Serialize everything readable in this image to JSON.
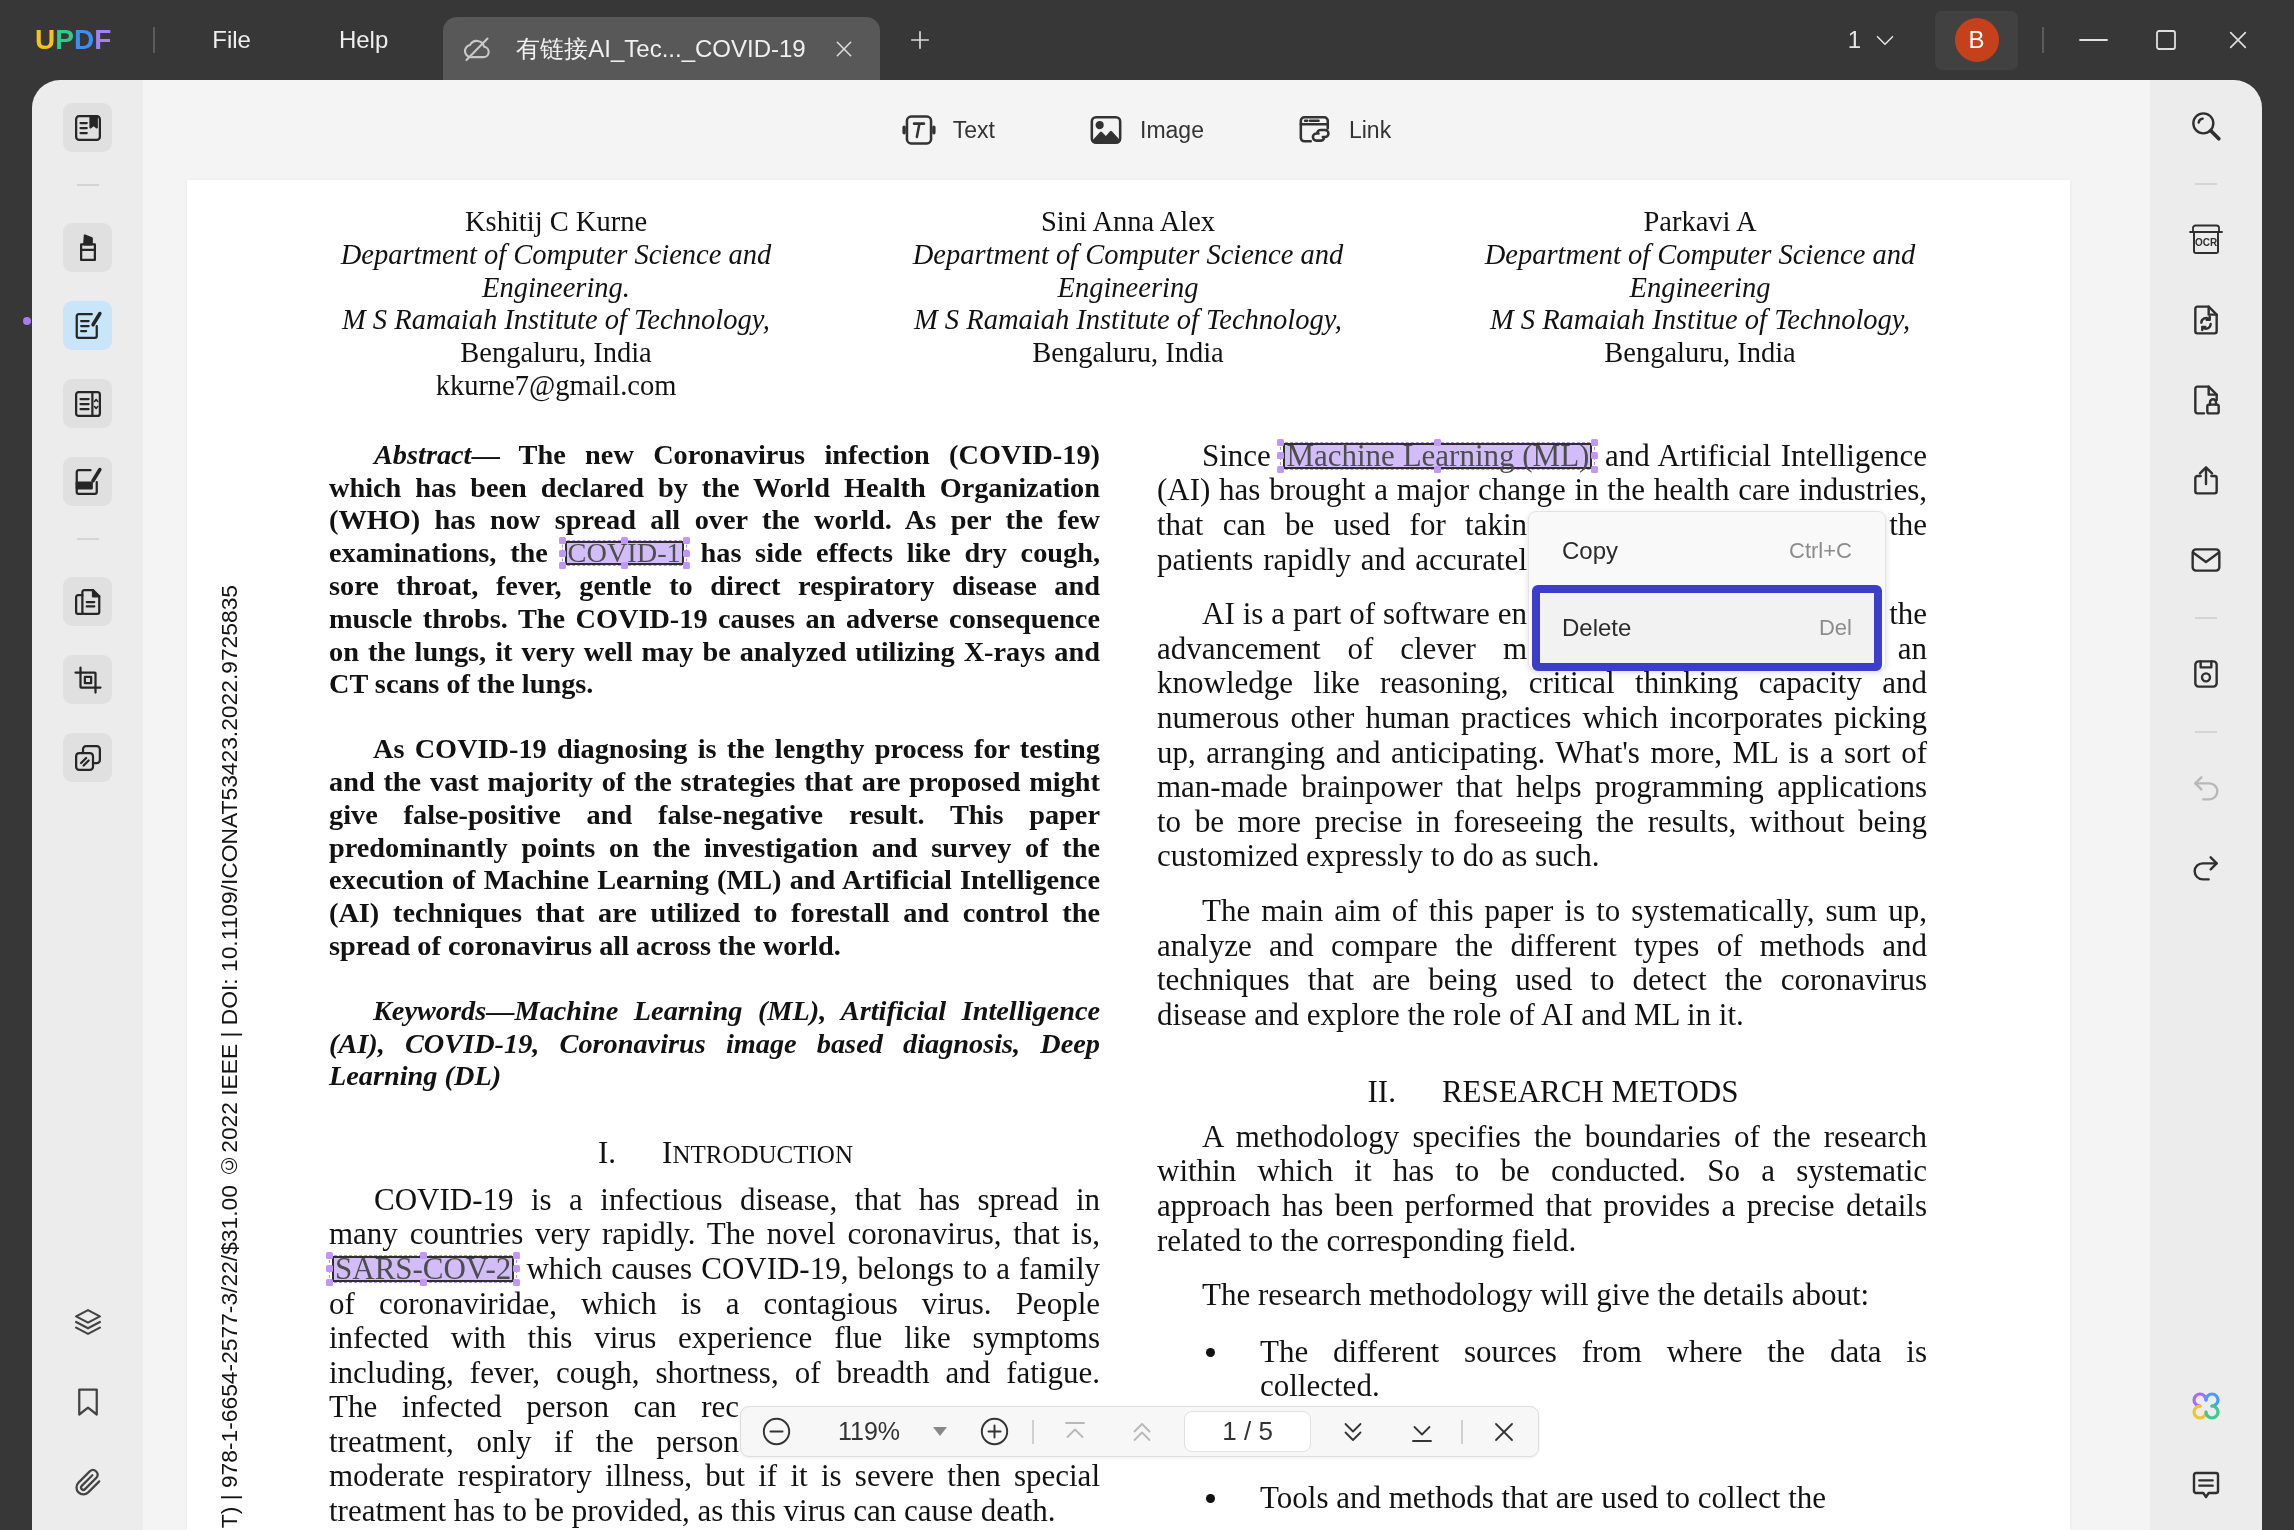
{
  "title_bar": {
    "logo": "UPDF",
    "menu": [
      "File",
      "Help"
    ],
    "tabs": [
      {
        "title": "有链接AI_Tec..._COVID-19",
        "selected": true
      }
    ],
    "counter": "1",
    "avatar": "B"
  },
  "left_toolbar": {
    "groups": [
      [
        {
          "kind": "book",
          "selected": false
        }
      ],
      [
        {
          "kind": "highlighter",
          "selected": false
        },
        {
          "kind": "edit",
          "selected": true
        },
        {
          "kind": "columns",
          "selected": false
        },
        {
          "kind": "sign",
          "selected": false
        }
      ],
      [
        {
          "kind": "pages",
          "selected": false
        },
        {
          "kind": "crop",
          "selected": false
        },
        {
          "kind": "stack",
          "selected": false
        }
      ]
    ],
    "bottom": [
      {
        "kind": "layers"
      },
      {
        "kind": "bookmark"
      },
      {
        "kind": "paperclip"
      }
    ]
  },
  "edit_toolbar": [
    {
      "kind": "text",
      "label": "Text"
    },
    {
      "kind": "image",
      "label": "Image"
    },
    {
      "kind": "link",
      "label": "Link"
    }
  ],
  "document": {
    "side_note": "T) | 978-1-6654-2577-3/22/$31.00 ©2022 IEEE | DOI: 10.1109/ICONAT53423.2022.9725835",
    "authors": [
      {
        "name": "Kshitij C Kurne",
        "department": "Department of Computer Science and Engineering.",
        "institute": "M S Ramaiah Institute of Technology,",
        "city": "Bengaluru, India",
        "email": "kkurne7@gmail.com"
      },
      {
        "name": "Sini Anna Alex",
        "department": "Department of Computer Science and Engineering",
        "institute": "M S Ramaiah Institute of Technology,",
        "city": "Bengaluru, India"
      },
      {
        "name": "Parkavi A",
        "department": "Department of Computer Science and Engineering",
        "institute": "M S Ramaiah Institue of Technology,",
        "city": "Bengaluru, India"
      }
    ],
    "columns": [
      [
        {
          "kind": "abstract",
          "lines": [
            {
              "covered": false,
              "parts": [
                {
                  "text": "*Abstract*— The new Coronavirus infection (COVID-19)",
                  "selected": false
                }
              ]
            },
            {
              "covered": false,
              "parts": [
                {
                  "text": "which has been declared by the World Health Organization",
                  "selected": false
                }
              ]
            },
            {
              "covered": false,
              "parts": [
                {
                  "text": "(WHO) has now spread all over the world. As per the few",
                  "selected": false
                }
              ]
            },
            {
              "covered": false,
              "parts": [
                {
                  "text": "examinations, the",
                  "selected": false
                },
                {
                  "text": "COVID-1",
                  "selected": true
                },
                {
                  "text": "has side effects like dry cough,",
                  "selected": false
                }
              ]
            },
            {
              "covered": false,
              "parts": [
                {
                  "text": "sore throat, fever, gentle to direct respiratory disease and",
                  "selected": false
                }
              ]
            },
            {
              "covered": false,
              "parts": [
                {
                  "text": "muscle throbs. The COVID-19 causes an adverse consequence",
                  "selected": false
                }
              ]
            },
            {
              "covered": false,
              "parts": [
                {
                  "text": "on the lungs, it very well may be analyzed utilizing X-rays and",
                  "selected": false
                }
              ]
            },
            {
              "covered": false,
              "parts": [
                {
                  "text": "CT scans of the lungs.",
                  "selected": false
                }
              ]
            }
          ]
        },
        {
          "kind": "bold",
          "runs": [
            {
              "text": "As COVID-19 diagnosing is the lengthy process for testing and the vast majority of the strategies that are proposed might give false-positive and false-negative result. This paper predominantly points on the investigation and survey of the execution of Machine Learning (ML) and Artificial Intelligence (AI) techniques that are utilized to forestall and control the spread of coronavirus all across the world.",
              "selected": false
            }
          ]
        },
        {
          "kind": "keywords",
          "runs": [
            {
              "text": "Keywords—Machine Learning (ML), Artificial Intelligence (AI), COVID-19, Coronavirus image based diagnosis, Deep Learning (DL)",
              "selected": false
            }
          ]
        },
        {
          "kind": "smallcaps",
          "number": "I.",
          "title": "INTRODUCTION"
        },
        {
          "kind": "lines",
          "lines": [
            {
              "covered": false,
              "parts": [
                {
                  "text": "COVID-19 is a infectious disease, that has spread in",
                  "selected": false
                }
              ]
            },
            {
              "covered": false,
              "parts": [
                {
                  "text": "many countries very rapidly. The novel coronavirus, that is,",
                  "selected": false
                }
              ]
            },
            {
              "covered": false,
              "parts": [
                {
                  "text": "SARS-COV-2",
                  "selected": true
                },
                {
                  "text": "which causes COVID-19, belongs to a family",
                  "selected": false
                }
              ]
            },
            {
              "covered": false,
              "parts": [
                {
                  "text": "of coronaviridae, which is a contagious virus. People",
                  "selected": false
                }
              ]
            },
            {
              "covered": false,
              "parts": [
                {
                  "text": "infected with this virus experience flue like symptoms",
                  "selected": false
                }
              ]
            },
            {
              "covered": false,
              "parts": [
                {
                  "text": "including, fever, cough, shortness, of breadth and fatigue.",
                  "selected": false
                }
              ]
            },
            {
              "covered": true,
              "parts": [
                {
                  "text": "The infected person can rec",
                  "selected": false
                }
              ]
            },
            {
              "covered": true,
              "parts": [
                {
                  "text": "treatment, only if the person",
                  "selected": false
                }
              ]
            },
            {
              "covered": false,
              "parts": [
                {
                  "text": "moderate respiratory illness, but if it is severe then special",
                  "selected": false
                }
              ]
            },
            {
              "covered": false,
              "parts": [
                {
                  "text": "treatment has to be provided, as this virus can cause death.",
                  "selected": false
                }
              ]
            }
          ]
        }
      ],
      [
        {
          "kind": "lines",
          "lines": [
            {
              "covered": false,
              "parts": [
                {
                  "text": "Since",
                  "selected": false
                },
                {
                  "text": "Machine Learning (ML)",
                  "selected": true
                },
                {
                  "text": "and Artificial Intelligence",
                  "selected": false
                }
              ]
            },
            {
              "covered": false,
              "parts": [
                {
                  "text": "(AI) has brought a major change in the health care industries,",
                  "selected": false
                }
              ]
            },
            {
              "covered": true,
              "parts": [
                {
                  "text": "that can be used for takin",
                  "selected": false
                },
                {
                  "text": "the",
                  "selected": false
                }
              ]
            },
            {
              "covered": true,
              "parts": [
                {
                  "text": "patients rapidly and accuratel",
                  "selected": false
                }
              ]
            }
          ]
        },
        {
          "kind": "lines",
          "lines": [
            {
              "covered": true,
              "parts": [
                {
                  "text": "AI is a part of software en",
                  "selected": false
                },
                {
                  "text": "the",
                  "selected": false
                }
              ]
            },
            {
              "covered": true,
              "parts": [
                {
                  "text": "advancement of clever m",
                  "selected": false
                },
                {
                  "text": "an",
                  "selected": false
                }
              ]
            },
            {
              "covered": false,
              "parts": [
                {
                  "text": "knowledge like reasoning, critical thinking capacity and",
                  "selected": false
                }
              ]
            },
            {
              "covered": false,
              "parts": [
                {
                  "text": "numerous other human practices which incorporates picking",
                  "selected": false
                }
              ]
            },
            {
              "covered": false,
              "parts": [
                {
                  "text": "up, arranging and anticipating. What's more, ML is a sort of",
                  "selected": false
                }
              ]
            },
            {
              "covered": false,
              "parts": [
                {
                  "text": "man-made brainpower that helps programming applications",
                  "selected": false
                }
              ]
            },
            {
              "covered": false,
              "parts": [
                {
                  "text": "to be more precise in foreseeing the results, without being",
                  "selected": false
                }
              ]
            },
            {
              "covered": false,
              "parts": [
                {
                  "text": "customized expressly to do as such.",
                  "selected": false
                }
              ]
            }
          ]
        },
        {
          "kind": "paragraph",
          "runs": [
            {
              "text": "The main aim of this paper is to systematically, sum up, analyze and compare the different types of methods and techniques that are being used to detect the coronavirus disease and explore the role of AI and ML in it.",
              "selected": false
            }
          ]
        },
        {
          "kind": "heading",
          "number": "II.",
          "title": "RESEARCH METODS"
        },
        {
          "kind": "paragraph",
          "runs": [
            {
              "text": "A methodology specifies the boundaries of the research within which it has to be conducted. So a systematic approach has been performed that provides a precise details related to the corresponding field.",
              "selected": false
            }
          ]
        },
        {
          "kind": "paragraph",
          "runs": [
            {
              "text": "The research methodology will give the details about:",
              "selected": false
            }
          ]
        },
        {
          "kind": "bullet",
          "runs": [
            {
              "text": "The different sources from where the data is collected.",
              "selected": false
            }
          ]
        },
        {
          "kind": "bullet",
          "runs": [
            {
              "text": "Tools and methods that are used to collect the",
              "selected": false
            }
          ]
        }
      ]
    ]
  },
  "context_menu": {
    "items": [
      {
        "label": "Copy",
        "shortcut": "Ctrl+C",
        "selected": false
      },
      {
        "label": "Delete",
        "shortcut": "Del",
        "selected": true
      }
    ]
  },
  "zoom_bar": {
    "zoom": "119%",
    "page": "1 / 5",
    "buttons": [
      {
        "kind": "first",
        "disabled": true
      },
      {
        "kind": "previous",
        "disabled": true
      },
      {
        "kind": "next",
        "disabled": false
      },
      {
        "kind": "last",
        "disabled": false
      }
    ]
  },
  "right_toolbar": {
    "groups": [
      [
        {
          "kind": "search",
          "disabled": false
        }
      ],
      [
        {
          "kind": "ocr",
          "label": "OCR",
          "disabled": false
        },
        {
          "kind": "convert",
          "disabled": false
        },
        {
          "kind": "protect",
          "disabled": false
        },
        {
          "kind": "share",
          "disabled": false
        },
        {
          "kind": "mail",
          "disabled": false
        }
      ],
      [
        {
          "kind": "save",
          "disabled": false
        }
      ],
      [
        {
          "kind": "undo",
          "disabled": true
        },
        {
          "kind": "redo",
          "disabled": false
        }
      ]
    ],
    "bottom": [
      {
        "kind": "ai"
      },
      {
        "kind": "comment"
      }
    ]
  }
}
